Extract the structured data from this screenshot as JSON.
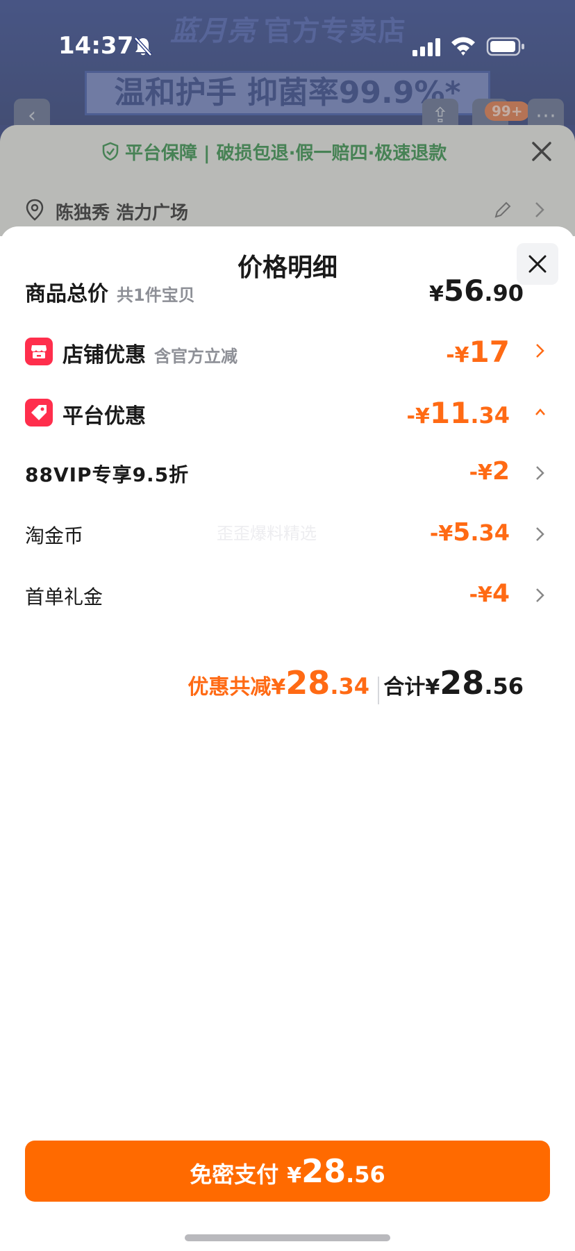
{
  "status_bar": {
    "time": "14:37"
  },
  "store": {
    "brand": "蓝月亮",
    "name": "官方专卖店",
    "promo": "温和护手 抑菌率99.9%*",
    "cart_badge": "99+"
  },
  "checkout": {
    "guarantee": "平台保障 | 破损包退·假一赔四·极速退款",
    "address": "陈独秀 浩力广场"
  },
  "sheet": {
    "title": "价格明细",
    "rows": [
      {
        "label": "商品总价",
        "sub": "共1件宝贝",
        "yen": "¥",
        "int": "56",
        "dec": ".90"
      },
      {
        "label": "店铺优惠",
        "sub": "含官方立减",
        "yen": "-¥",
        "int": "17",
        "dec": ""
      },
      {
        "label": "平台优惠",
        "sub": "",
        "yen": "-¥",
        "int": "11",
        "dec": ".34"
      },
      {
        "label": "88VIP专享9.5折",
        "sub": "",
        "yen": "-¥",
        "int": "2",
        "dec": ""
      },
      {
        "label": "淘金币",
        "sub": "",
        "yen": "-¥",
        "int": "5",
        "dec": ".34"
      },
      {
        "label": "首单礼金",
        "sub": "",
        "yen": "-¥",
        "int": "4",
        "dec": ""
      }
    ],
    "summary": {
      "discount_label": "优惠共减",
      "discount_yen": "¥",
      "discount_int": "28",
      "discount_dec": ".34",
      "total_label": "合计",
      "total_yen": "¥",
      "total_int": "28",
      "total_dec": ".56"
    },
    "watermark": "歪歪爆料精选"
  },
  "pay_button": {
    "label": "免密支付",
    "yen": "¥",
    "int": "28",
    "dec": ".56"
  },
  "colors": {
    "accent": "#ff6a14",
    "button": "#ff6a00",
    "tile": "#ff2e4c",
    "guarantee_green": "#1f8a3a"
  }
}
